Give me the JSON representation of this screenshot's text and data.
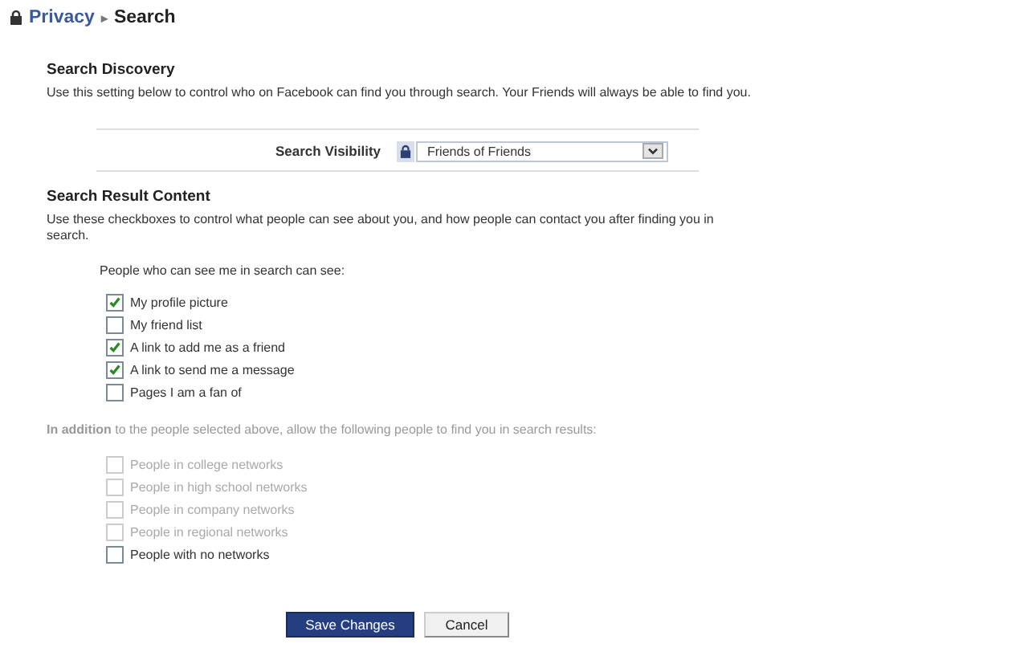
{
  "breadcrumb": {
    "parent": "Privacy",
    "separator": "▸",
    "current": "Search"
  },
  "discovery": {
    "heading": "Search Discovery",
    "description": "Use this setting below to control who on Facebook can find you through search. Your Friends will always be able to find you.",
    "visibility_label": "Search Visibility",
    "visibility_value": "Friends of Friends"
  },
  "result_content": {
    "heading": "Search Result Content",
    "description": "Use these checkboxes to control what people can see about you, and how people can contact you after finding you in search.",
    "intro": "People who can see me in search can see:",
    "options": [
      {
        "label": "My profile picture",
        "checked": true
      },
      {
        "label": "My friend list",
        "checked": false
      },
      {
        "label": "A link to add me as a friend",
        "checked": true
      },
      {
        "label": "A link to send me a message",
        "checked": true
      },
      {
        "label": "Pages I am a fan of",
        "checked": false
      }
    ]
  },
  "networks": {
    "intro": "**In addition** to the people selected above, allow the following people to find you in search results:",
    "options": [
      {
        "label": "People in college networks",
        "checked": false,
        "disabled": true
      },
      {
        "label": "People in high school networks",
        "checked": false,
        "disabled": true
      },
      {
        "label": "People in company networks",
        "checked": false,
        "disabled": true
      },
      {
        "label": "People in regional networks",
        "checked": false,
        "disabled": true
      },
      {
        "label": "People with no networks",
        "checked": false,
        "disabled": false
      }
    ]
  },
  "buttons": [
    {
      "label": "Save Changes",
      "kind": "primary"
    },
    {
      "label": "Cancel",
      "kind": "secondary"
    }
  ]
}
